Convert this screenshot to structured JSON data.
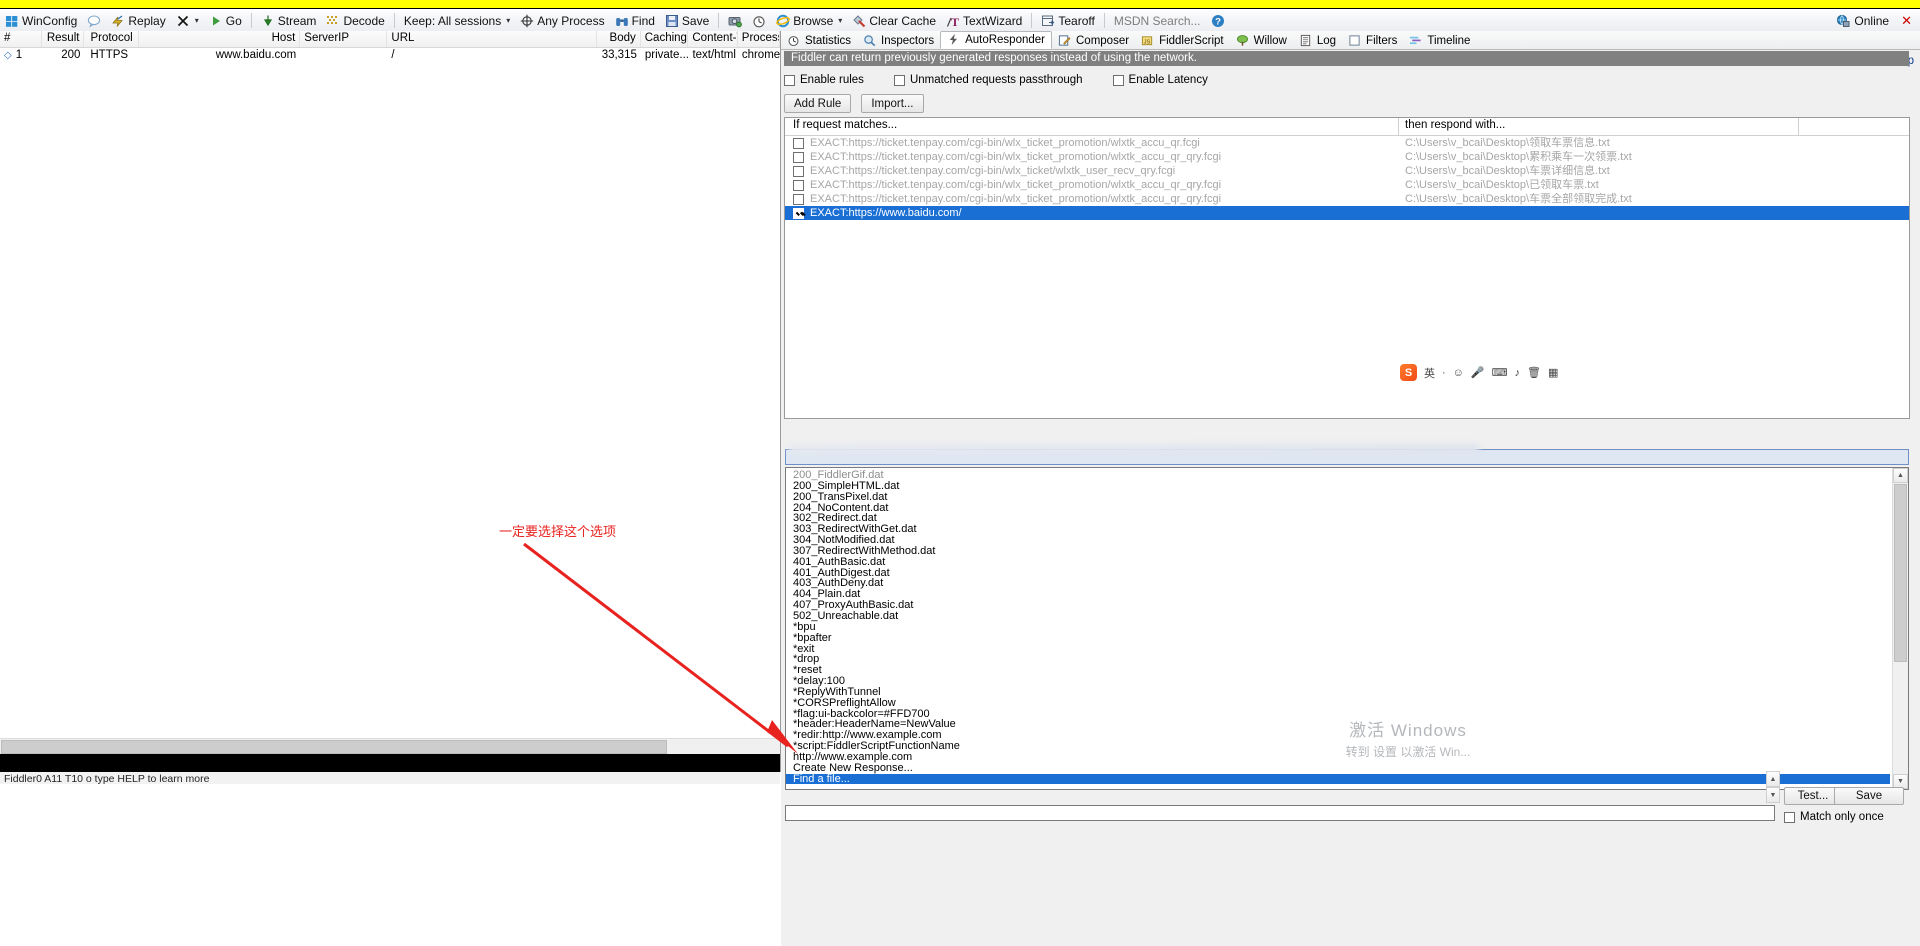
{
  "toolbar": {
    "items": [
      {
        "icon": "windows-icon",
        "label": "WinConfig"
      },
      {
        "icon": "comment-icon",
        "label": ""
      },
      {
        "icon": "replay-icon",
        "label": "Replay"
      },
      {
        "icon": "remove-icon",
        "label": "",
        "caret": "▾"
      },
      {
        "icon": "go-icon",
        "label": "Go"
      },
      {
        "icon": "stream-icon",
        "label": "Stream"
      },
      {
        "icon": "decode-icon",
        "label": "Decode"
      },
      {
        "icon": "keep-icon",
        "label": "Keep: All sessions",
        "caret": "▾"
      },
      {
        "icon": "any-process-icon",
        "label": "Any Process"
      },
      {
        "icon": "find-icon",
        "label": "Find"
      },
      {
        "icon": "save-icon",
        "label": "Save"
      },
      {
        "icon": "screenshot-icon",
        "label": ""
      },
      {
        "icon": "timer-icon",
        "label": ""
      },
      {
        "icon": "browse-icon",
        "label": "Browse",
        "caret": "▾"
      },
      {
        "icon": "clear-cache-icon",
        "label": "Clear Cache"
      },
      {
        "icon": "textwizard-icon",
        "label": "TextWizard"
      },
      {
        "icon": "tearoff-icon",
        "label": "Tearoff"
      },
      {
        "icon": "",
        "label": "MSDN Search...",
        "gray": true
      },
      {
        "icon": "help-icon",
        "label": ""
      }
    ],
    "online_label": "Online",
    "close_label": "✕"
  },
  "sessions": {
    "columns": [
      "#",
      "Result",
      "Protocol",
      "Host",
      "ServerIP",
      "URL",
      "Body",
      "Caching",
      "Content-Type",
      "Process"
    ],
    "rows": [
      {
        "num": "1",
        "result": "200",
        "protocol": "HTTPS",
        "host": "www.baidu.com",
        "serverip": "",
        "url": "/",
        "body": "33,315",
        "caching": "private...",
        "content_type": "text/html",
        "process": "chrome..."
      }
    ],
    "statusbar": "Fiddler0 A11 T10 o type HELP to learn more"
  },
  "right_tabs": [
    {
      "icon": "statistics-icon",
      "label": "Statistics",
      "active": false
    },
    {
      "icon": "inspectors-icon",
      "label": "Inspectors",
      "active": false
    },
    {
      "icon": "autoresponder-icon",
      "label": "AutoResponder",
      "active": true
    },
    {
      "icon": "composer-icon",
      "label": "Composer",
      "active": false
    },
    {
      "icon": "fiddlerscript-icon",
      "label": "FiddlerScript",
      "active": false
    },
    {
      "icon": "willow-icon",
      "label": "Willow",
      "active": false
    },
    {
      "icon": "log-icon",
      "label": "Log",
      "active": false
    },
    {
      "icon": "filters-icon",
      "label": "Filters",
      "active": false
    },
    {
      "icon": "timeline-icon",
      "label": "Timeline",
      "active": false
    }
  ],
  "help_link": "Help",
  "autoresponder": {
    "banner": "Fiddler can return previously generated responses instead of using the network.",
    "checkboxes": [
      {
        "label": "Enable rules",
        "checked": false
      },
      {
        "label": "Unmatched requests passthrough",
        "checked": false
      },
      {
        "label": "Enable Latency",
        "checked": false
      }
    ],
    "buttons": {
      "add_rule": "Add Rule",
      "import": "Import..."
    },
    "grid_headers": {
      "match": "If request matches...",
      "respond": "then respond with..."
    },
    "rules": [
      {
        "checked": false,
        "selected": false,
        "match": "EXACT:https://ticket.tenpay.com/cgi-bin/wlx_ticket_promotion/wlxtk_accu_qr.fcgi",
        "respond": "C:\\Users\\v_bcai\\Desktop\\领取车票信息.txt"
      },
      {
        "checked": false,
        "selected": false,
        "match": "EXACT:https://ticket.tenpay.com/cgi-bin/wlx_ticket_promotion/wlxtk_accu_qr_qry.fcgi",
        "respond": "C:\\Users\\v_bcai\\Desktop\\累积乘车一次领票.txt"
      },
      {
        "checked": false,
        "selected": false,
        "match": "EXACT:https://ticket.tenpay.com/cgi-bin/wlx_ticket/wlxtk_user_recv_qry.fcgi",
        "respond": "C:\\Users\\v_bcai\\Desktop\\车票详细信息.txt"
      },
      {
        "checked": false,
        "selected": false,
        "match": "EXACT:https://ticket.tenpay.com/cgi-bin/wlx_ticket_promotion/wlxtk_accu_qr_qry.fcgi",
        "respond": "C:\\Users\\v_bcai\\Desktop\\已领取车票.txt"
      },
      {
        "checked": false,
        "selected": false,
        "match": "EXACT:https://ticket.tenpay.com/cgi-bin/wlx_ticket_promotion/wlxtk_accu_qr_qry.fcgi",
        "respond": "C:\\Users\\v_bcai\\Desktop\\车票全部领取完成.txt"
      },
      {
        "checked": true,
        "selected": true,
        "match": "EXACT:https://www.baidu.com/",
        "respond": ""
      }
    ],
    "response_options": [
      "200_FiddlerGif.dat",
      "200_SimpleHTML.dat",
      "200_TransPixel.dat",
      "204_NoContent.dat",
      "302_Redirect.dat",
      "303_RedirectWithGet.dat",
      "304_NotModified.dat",
      "307_RedirectWithMethod.dat",
      "401_AuthBasic.dat",
      "401_AuthDigest.dat",
      "403_AuthDeny.dat",
      "404_Plain.dat",
      "407_ProxyAuthBasic.dat",
      "502_Unreachable.dat",
      "*bpu",
      "*bpafter",
      "*exit",
      "*drop",
      "*reset",
      "*delay:100",
      "*ReplyWithTunnel",
      "*CORSPreflightAllow",
      "*flag:ui-backcolor=#FFD700",
      "*header:HeaderName=NewValue",
      "*redir:http://www.example.com",
      "*script:FiddlerScriptFunctionName",
      "http://www.example.com",
      "Create New Response..."
    ],
    "selected_option": "Find a file...",
    "find_input_value": "",
    "test_button": "Test...",
    "save_button": "Save",
    "match_once_label": "Match only once",
    "match_once_checked": false
  },
  "ime": {
    "logo": "S",
    "lang": "英",
    "glyphs": [
      "·",
      "☺",
      "🎤",
      "⌨",
      "♪",
      "🗑",
      "▦"
    ]
  },
  "annotation": {
    "text": "一定要选择这个选项",
    "color": "#e8231f"
  },
  "watermark": {
    "line1": "激活 Windows",
    "line2": "转到 设置 以激活 Win..."
  }
}
